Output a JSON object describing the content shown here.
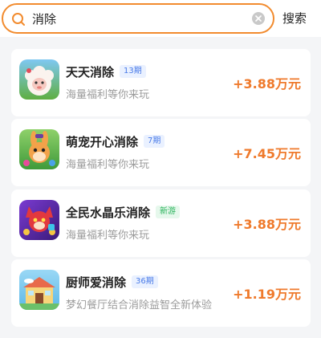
{
  "search": {
    "value": "消除",
    "button_label": "搜索"
  },
  "colors": {
    "accent": "#f28b2e",
    "reward": "#ef7a2c",
    "badge_period_bg": "#eaf1ff",
    "badge_period_text": "#4a7be8",
    "badge_new_bg": "#e6f8ec",
    "badge_new_text": "#2bb35c"
  },
  "games": [
    {
      "name": "天天消除",
      "badge": "13期",
      "badge_type": "period",
      "description": "海量福利等你来玩",
      "reward": "+3.88万元",
      "icon": "sheep-game-icon"
    },
    {
      "name": "萌宠开心消除",
      "badge": "7期",
      "badge_type": "period",
      "description": "海量福利等你来玩",
      "reward": "+7.45万元",
      "icon": "rabbit-game-icon"
    },
    {
      "name": "全民水晶乐消除",
      "badge": "新游",
      "badge_type": "new",
      "description": "海量福利等你来玩",
      "reward": "+3.88万元",
      "icon": "fox-game-icon"
    },
    {
      "name": "厨师爱消除",
      "badge": "36期",
      "badge_type": "period",
      "description": "梦幻餐厅结合消除益智全新体验",
      "reward": "+1.19万元",
      "icon": "restaurant-game-icon"
    }
  ]
}
